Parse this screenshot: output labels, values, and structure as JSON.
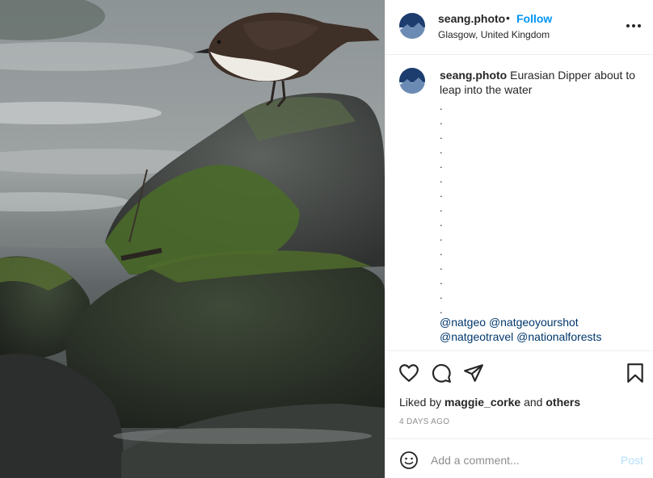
{
  "post": {
    "image_alt": "Eurasian Dipper perched on a mossy rock above a river",
    "author": {
      "username": "seang.photo",
      "separator": "•",
      "follow_label": "Follow",
      "location": "Glasgow, United Kingdom"
    },
    "caption": {
      "username": "seang.photo",
      "text": "Eurasian Dipper about to leap into the water",
      "dots": ".\n.\n.\n.\n.\n.\n.\n.\n.\n.\n.\n.\n.\n.\n.",
      "tags": [
        "@natgeo",
        "@natgeoyourshot",
        "@natgeotravel",
        "@nationalforests"
      ]
    },
    "actions": {
      "like_icon": "heart-icon",
      "comment_icon": "comment-icon",
      "share_icon": "share-icon",
      "save_icon": "bookmark-icon"
    },
    "likes": {
      "prefix": "Liked by",
      "user": "maggie_corke",
      "conjunction": "and",
      "others": "others"
    },
    "timestamp": "4 DAYS AGO",
    "comment_box": {
      "placeholder": "Add a comment...",
      "post_label": "Post"
    },
    "colors": {
      "link_blue": "#0095f6",
      "post_disabled": "#b2dffc",
      "tag_color": "#00376b",
      "muted": "#8e8e8e"
    }
  }
}
